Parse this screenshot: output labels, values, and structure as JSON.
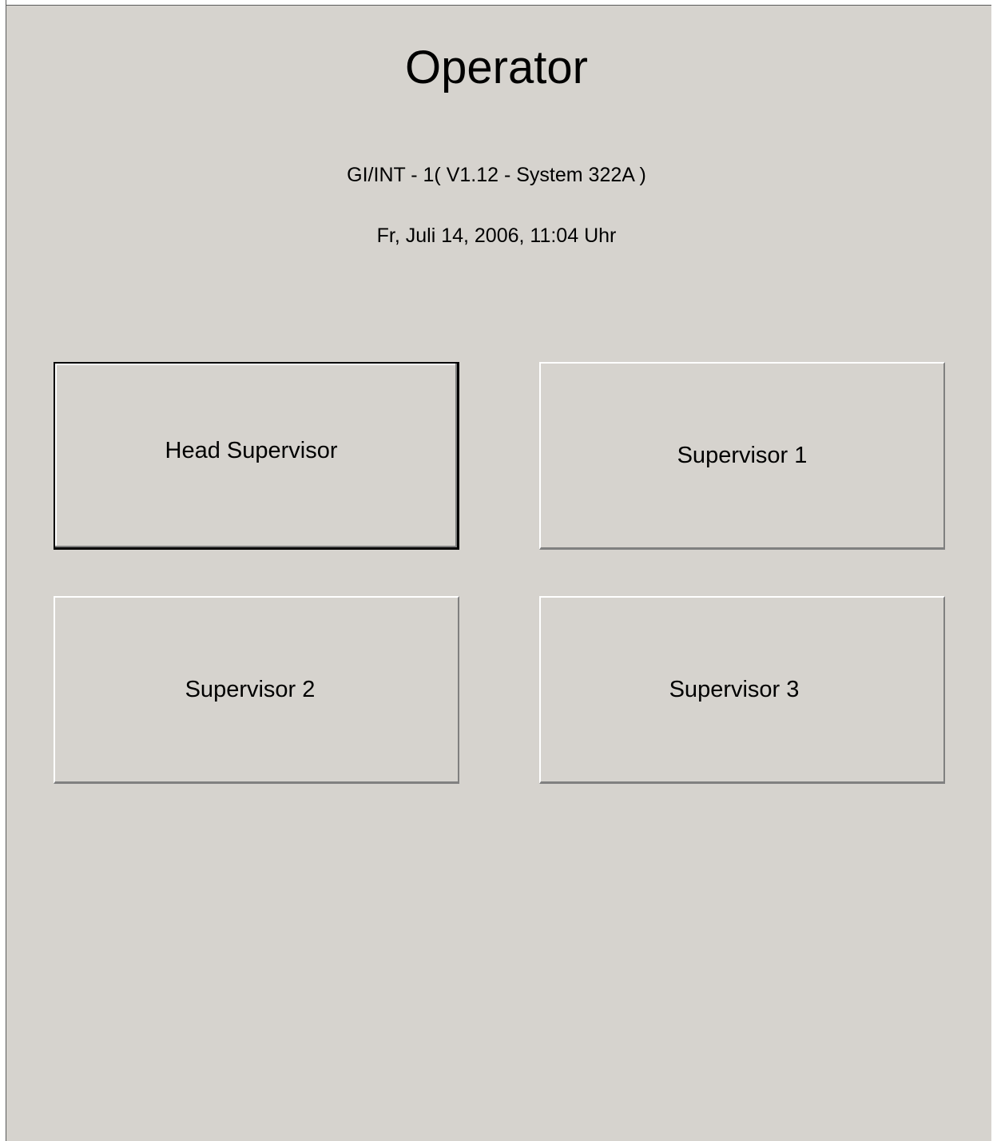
{
  "header": {
    "title": "Operator",
    "subtitle": "GI/INT - 1( V1.12 - System 322A )",
    "datetime": "Fr, Juli 14, 2006, 11:04 Uhr"
  },
  "buttons": {
    "head_supervisor": "Head Supervisor",
    "supervisor_1": "Supervisor 1",
    "supervisor_2": "Supervisor 2",
    "supervisor_3": "Supervisor 3"
  },
  "colors": {
    "background": "#d6d3ce",
    "text": "#000000"
  }
}
